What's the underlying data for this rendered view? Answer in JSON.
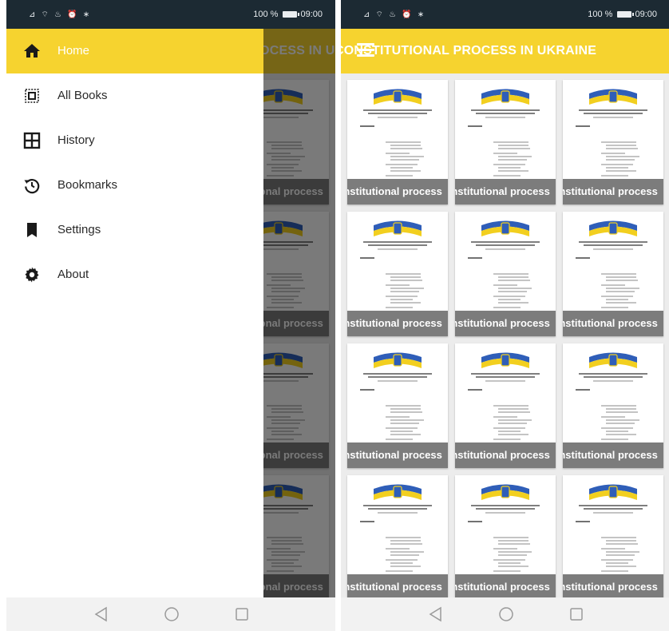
{
  "status_bar": {
    "signal_icons": "⊿ ⌔ ♨ ⏰ ∗",
    "battery_text": "100 %",
    "time": "09:00"
  },
  "app_bar": {
    "title": "CONSTITUTIONAL PROCESS IN UKRAINE",
    "menu_icon": "hamburger-icon"
  },
  "drawer": {
    "items": [
      {
        "label": "Home",
        "icon": "home-icon",
        "active": true
      },
      {
        "label": "All Books",
        "icon": "all-books-icon",
        "active": false
      },
      {
        "label": "History",
        "icon": "grid-icon",
        "active": false
      },
      {
        "label": "Bookmarks",
        "icon": "history-icon",
        "active": false
      },
      {
        "label": "Settings",
        "icon": "bookmark-icon",
        "active": false
      },
      {
        "label": "About",
        "icon": "gear-icon",
        "active": false
      }
    ]
  },
  "books": [
    {
      "title": "Constitutional process"
    },
    {
      "title": "Constitutional process"
    },
    {
      "title": "Constitutional process"
    },
    {
      "title": "Constitutional process"
    },
    {
      "title": "Constitutional process"
    },
    {
      "title": "Constitutional process"
    },
    {
      "title": "Constitutional process"
    },
    {
      "title": "Constitutional process"
    },
    {
      "title": "Constitutional process"
    },
    {
      "title": "Constitutional process"
    },
    {
      "title": "Constitutional process"
    },
    {
      "title": "Constitutional process"
    }
  ],
  "nav_bar": {
    "back_icon": "back-triangle-icon",
    "home_icon": "home-circle-icon",
    "recents_icon": "recents-square-icon"
  },
  "colors": {
    "accent": "#f6d32f",
    "status_bar": "#1c2a33",
    "label_bg": "#7c7c7c",
    "flag_blue": "#2f5eb8",
    "flag_yellow": "#f2cf1f"
  }
}
